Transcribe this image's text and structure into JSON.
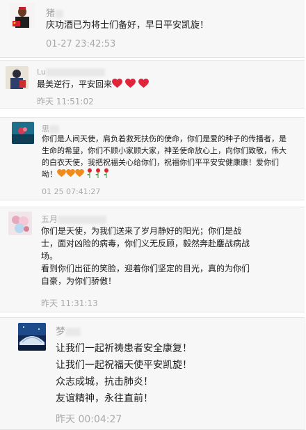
{
  "comments": [
    {
      "name_visible": "猪",
      "lines": [
        "庆功酒已为将士们备好，早日平安凯旋！"
      ],
      "time": "01-27 23:42:53"
    },
    {
      "name_visible": "Lu",
      "lines": [
        "最美逆行，平安回来"
      ],
      "emoji": [
        "red-heart",
        "red-heart",
        "red-heart"
      ],
      "time": "昨天 11:51:02"
    },
    {
      "name_visible": "思",
      "lines": [
        "你们是人间天使，肩负着救死扶伤的使命，你们是爱的种子的传播者，是",
        "生命的希望，你们不顾小家顾大家，神圣使命放心上，向你们致敬，伟大",
        "的白衣天使，我把祝福关心给你们，祝福你们平平安安健康康！爱你们",
        "呦！"
      ],
      "emoji": [
        "orange-heart",
        "orange-heart",
        "orange-heart",
        "rose",
        "rose",
        "rose"
      ],
      "time": "01 25 07:41:27"
    },
    {
      "name_visible": "五月",
      "lines": [
        "你们是天使，为我们送来了岁月静好的阳光；你们是战",
        "士，面对凶险的病毒，你们义无反顾，毅然奔赴鏖战病战",
        "场。",
        "看到你们出征的笑脸，迎着你们坚定的目光，真的为你们",
        "自豪，为你们骄傲！"
      ],
      "time": "昨天 11:31:13"
    },
    {
      "name_visible": "梦",
      "lines": [
        "让我们一起祈祷患者安全康复！",
        "让我们一起祝福天使平安凯旋！",
        "众志成城，抗击肺炎！",
        "友谊精神，永往直前！"
      ],
      "time": "昨天 00:04:27"
    }
  ],
  "colors": {
    "card_bg": "#f7f7f7",
    "text": "#1b1b1b",
    "meta": "#a9a9a9",
    "heart_red": "#e0243a",
    "heart_orange": "#f08a1c",
    "rose": "#d9262f"
  }
}
